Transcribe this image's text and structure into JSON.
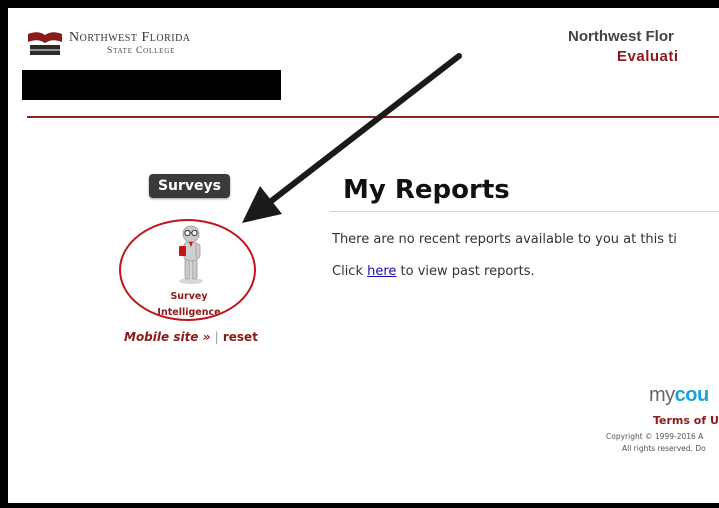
{
  "header": {
    "logo": {
      "line1": "Northwest Florida",
      "line2": "State College"
    },
    "title": "Northwest Flor",
    "subtitle": "Evaluati"
  },
  "sidebar": {
    "tab_label": "Surveys",
    "app": {
      "icon": "survey-intelligence-figure-icon",
      "label_line1": "Survey",
      "label_line2": "Intelligence"
    },
    "mobile_link": "Mobile site »",
    "separator": "|",
    "reset_link": "reset"
  },
  "main": {
    "title": "My Reports",
    "no_reports_text": "There are no recent reports available to you at this ti",
    "past_reports": {
      "prefix": "Click ",
      "link": "here",
      "suffix": " to view past reports."
    }
  },
  "footer": {
    "brand_prefix": "my",
    "brand_accent": "cou",
    "terms": "Terms of Use",
    "copyright_line1": "Copyright © 1999-2016 A",
    "copyright_line2": "All rights reserved. Do"
  },
  "colors": {
    "accent": "#8b1a1a",
    "annotation_red": "#c0151c",
    "brand_blue": "#1aa3d9",
    "link_blue": "#1a0dab",
    "tab_dark": "#3a3a3a"
  }
}
